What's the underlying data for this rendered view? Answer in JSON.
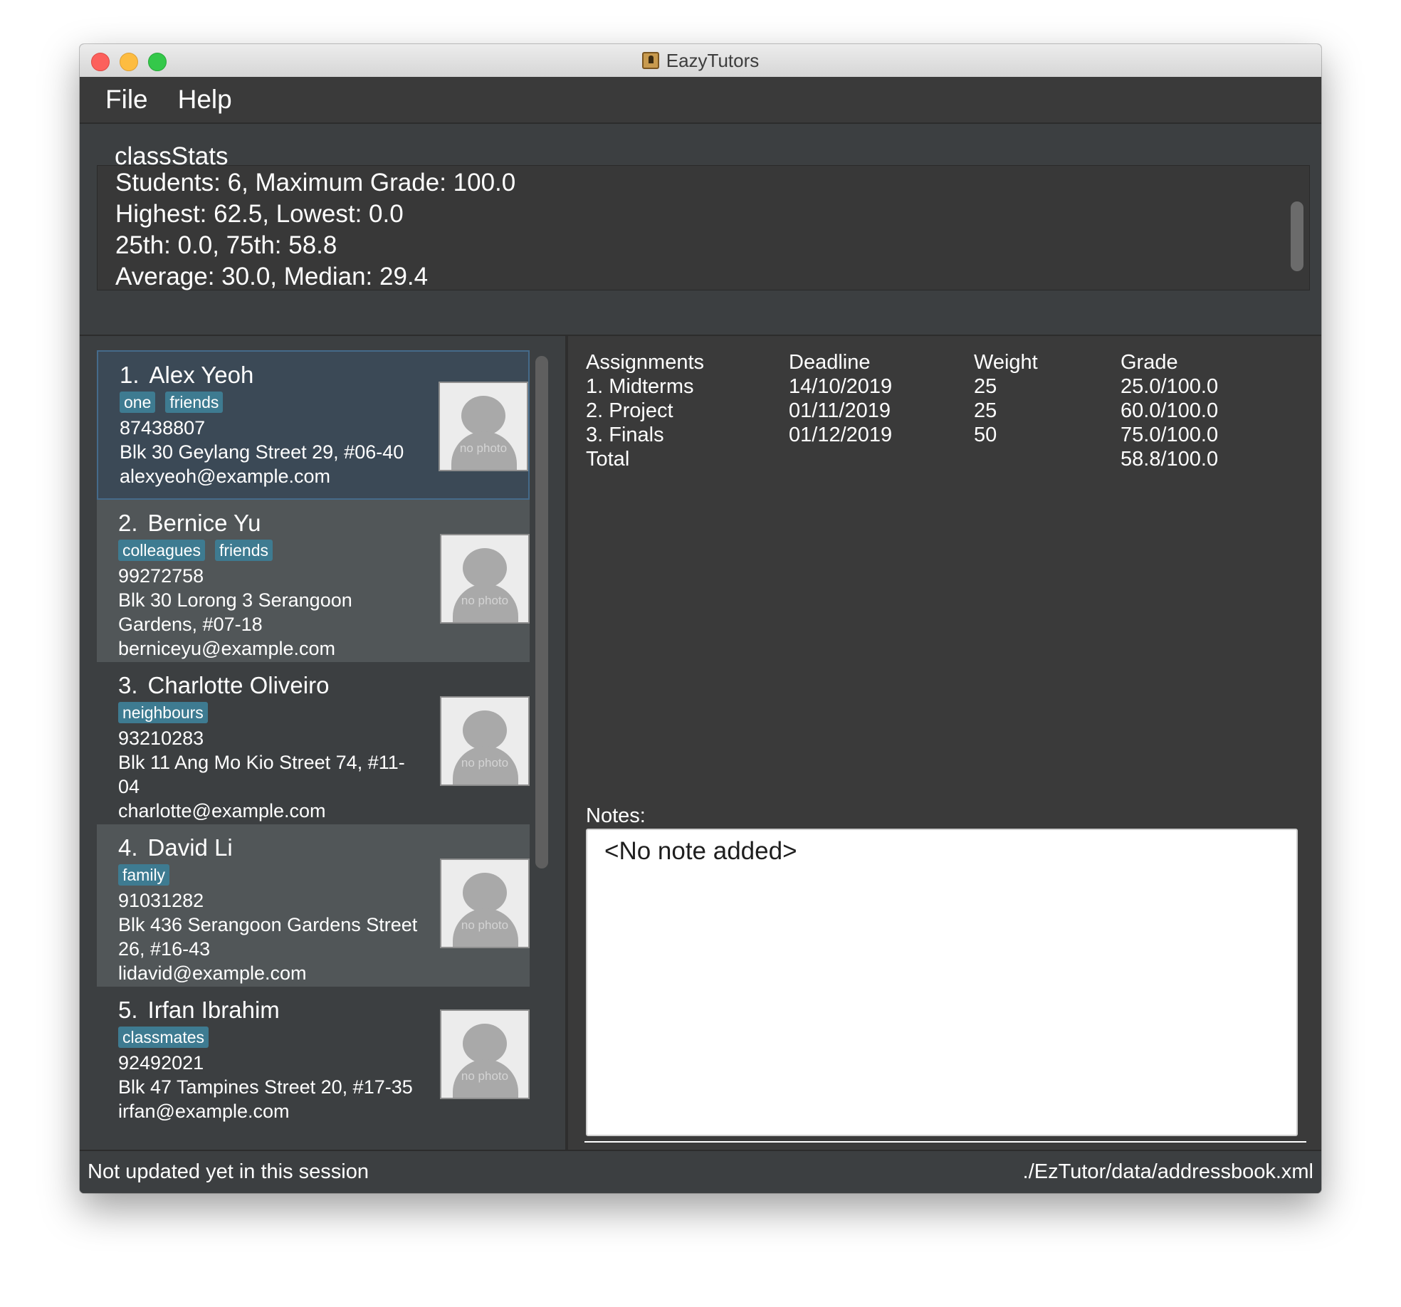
{
  "window": {
    "title": "EazyTutors"
  },
  "menu": {
    "file": "File",
    "help": "Help"
  },
  "command": {
    "value": "classStats"
  },
  "result": {
    "lines": [
      "Students: 6, Maximum Grade: 100.0",
      "Highest: 62.5, Lowest: 0.0",
      "25th: 0.0, 75th: 58.8",
      "Average: 30.0, Median: 29.4"
    ]
  },
  "persons": [
    {
      "index": "1.",
      "name": "Alex Yeoh",
      "tags": [
        "one",
        "friends"
      ],
      "phone": "87438807",
      "address": "Blk 30 Geylang Street 29, #06-40",
      "email": "alexyeoh@example.com",
      "photo": "no photo",
      "selected": true
    },
    {
      "index": "2.",
      "name": "Bernice Yu",
      "tags": [
        "colleagues",
        "friends"
      ],
      "phone": "99272758",
      "address": "Blk 30 Lorong 3 Serangoon Gardens, #07-18",
      "email": "berniceyu@example.com",
      "photo": "no photo"
    },
    {
      "index": "3.",
      "name": "Charlotte Oliveiro",
      "tags": [
        "neighbours"
      ],
      "phone": "93210283",
      "address": "Blk 11 Ang Mo Kio Street 74, #11-04",
      "email": "charlotte@example.com",
      "photo": "no photo"
    },
    {
      "index": "4.",
      "name": "David Li",
      "tags": [
        "family"
      ],
      "phone": "91031282",
      "address": "Blk 436 Serangoon Gardens Street 26, #16-43",
      "email": "lidavid@example.com",
      "photo": "no photo"
    },
    {
      "index": "5.",
      "name": "Irfan Ibrahim",
      "tags": [
        "classmates"
      ],
      "phone": "92492021",
      "address": "Blk 47 Tampines Street 20, #17-35",
      "email": "irfan@example.com",
      "photo": "no photo"
    }
  ],
  "grades": {
    "headers": [
      "Assignments",
      "Deadline",
      "Weight",
      "Grade"
    ],
    "rows": [
      [
        "1. Midterms",
        "14/10/2019",
        "25",
        "25.0/100.0"
      ],
      [
        "2. Project",
        "01/11/2019",
        "25",
        "60.0/100.0"
      ],
      [
        "3. Finals",
        "01/12/2019",
        "50",
        "75.0/100.0"
      ],
      [
        "Total",
        "",
        "",
        "58.8/100.0"
      ]
    ]
  },
  "notes": {
    "label": "Notes:",
    "content": "<No note added>"
  },
  "status": {
    "sync": "Not updated yet in this session",
    "path": "./EzTutor/data/addressbook.xml"
  },
  "colors": {
    "background": "#3c3f41",
    "tag": "#3e7b91",
    "selected_card": "#3b4956",
    "alt_card": "#515658"
  }
}
